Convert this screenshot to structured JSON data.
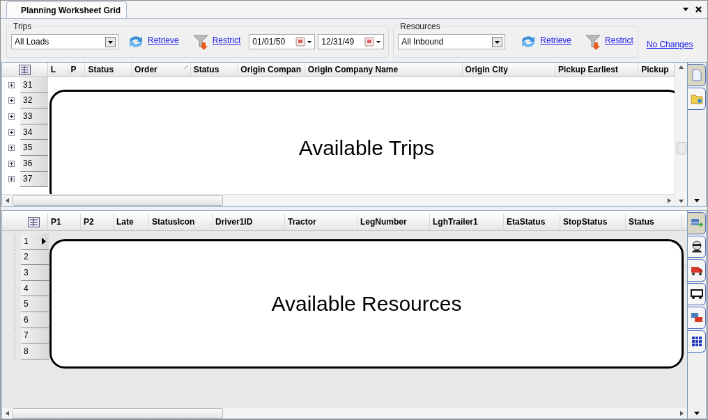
{
  "window": {
    "tab": "Planning Worksheet Grid"
  },
  "trips": {
    "group_label": "Trips",
    "filter": "All Loads",
    "retrieve": "Retrieve",
    "restrict": "Restrict",
    "date_from": "01/01/50",
    "date_to": "12/31/49"
  },
  "resources": {
    "group_label": "Resources",
    "filter": "All Inbound",
    "retrieve": "Retrieve",
    "restrict": "Restrict"
  },
  "status_link": "No Changes",
  "trips_grid": {
    "columns": [
      {
        "label": "L",
        "sorted": false
      },
      {
        "label": "P",
        "sorted": false
      },
      {
        "label": "Status",
        "sorted": false
      },
      {
        "label": "Order",
        "sorted": true
      },
      {
        "label": "Status",
        "sorted": false
      },
      {
        "label": "Origin Compan",
        "sorted": false
      },
      {
        "label": "Origin Company Name",
        "sorted": false
      },
      {
        "label": "Origin City",
        "sorted": false
      },
      {
        "label": "Pickup Earliest",
        "sorted": false
      },
      {
        "label": "Pickup",
        "sorted": false
      }
    ],
    "rows": [
      {
        "number": "31",
        "expanded": false
      },
      {
        "number": "32",
        "expanded": false
      },
      {
        "number": "33",
        "expanded": false
      },
      {
        "number": "34",
        "expanded": false
      },
      {
        "number": "35",
        "expanded": false
      },
      {
        "number": "36",
        "expanded": false
      },
      {
        "number": "37",
        "expanded": false
      }
    ],
    "callout": "Available Trips"
  },
  "resources_grid": {
    "columns": [
      {
        "label": "P1",
        "sorted": false
      },
      {
        "label": "P2",
        "sorted": false
      },
      {
        "label": "Late",
        "sorted": false
      },
      {
        "label": "StatusIcon",
        "sorted": false
      },
      {
        "label": "Driver1ID",
        "sorted": false
      },
      {
        "label": "Tractor",
        "sorted": false
      },
      {
        "label": "LegNumber",
        "sorted": false
      },
      {
        "label": "LghTrailer1",
        "sorted": false
      },
      {
        "label": "EtaStatus",
        "sorted": false
      },
      {
        "label": "StopStatus",
        "sorted": false
      },
      {
        "label": "Status",
        "sorted": false
      }
    ],
    "rows": [
      {
        "number": "1",
        "current": true
      },
      {
        "number": "2",
        "current": false
      },
      {
        "number": "3",
        "current": false
      },
      {
        "number": "4",
        "current": false
      },
      {
        "number": "5",
        "current": false
      },
      {
        "number": "6",
        "current": false
      },
      {
        "number": "7",
        "current": false
      },
      {
        "number": "8",
        "current": false
      }
    ],
    "callout": "Available Resources"
  },
  "trips_side_tabs": [
    {
      "kind": "page",
      "selected": true
    },
    {
      "kind": "folder",
      "selected": false
    }
  ],
  "resources_side_tabs": [
    {
      "kind": "transfer",
      "selected": true
    },
    {
      "kind": "driver",
      "selected": false
    },
    {
      "kind": "truck",
      "selected": false
    },
    {
      "kind": "trailer",
      "selected": false
    },
    {
      "kind": "combo",
      "selected": false
    },
    {
      "kind": "grid",
      "selected": false
    }
  ]
}
